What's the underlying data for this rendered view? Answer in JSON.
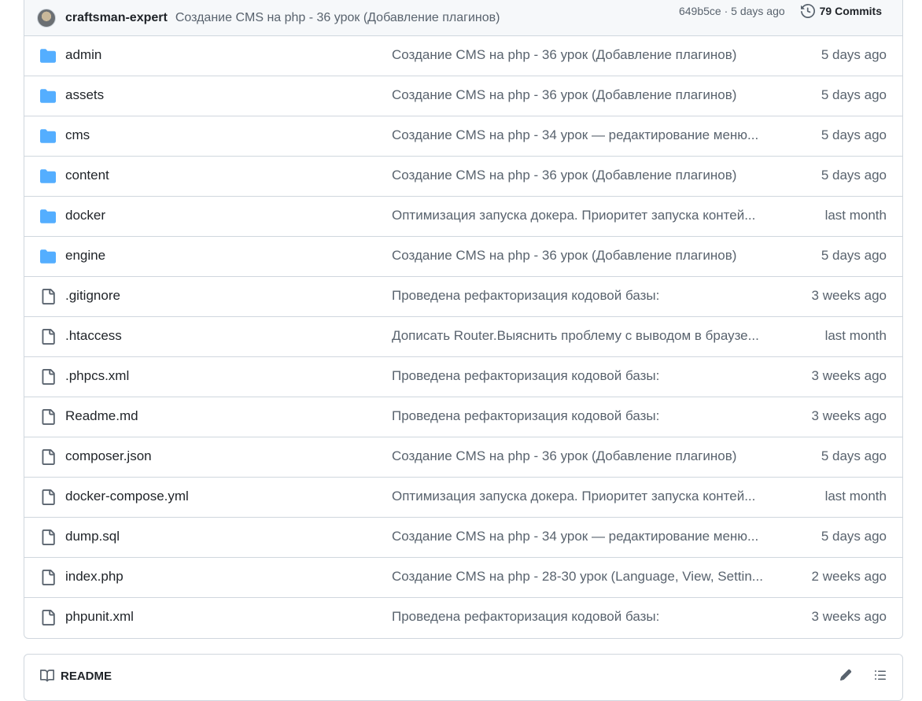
{
  "latest_commit": {
    "author": "craftsman-expert",
    "message": "Создание CMS на php - 36 урок (Добавление плагинов)",
    "sha_time": "649b5ce · 5 days ago",
    "commits_label": "79 Commits"
  },
  "files": [
    {
      "type": "folder",
      "name": "admin",
      "message": "Создание CMS на php - 36 урок (Добавление плагинов)",
      "age": "5 days ago"
    },
    {
      "type": "folder",
      "name": "assets",
      "message": "Создание CMS на php - 36 урок (Добавление плагинов)",
      "age": "5 days ago"
    },
    {
      "type": "folder",
      "name": "cms",
      "message": "Создание CMS на php - 34 урок — редактирование меню...",
      "age": "5 days ago"
    },
    {
      "type": "folder",
      "name": "content",
      "message": "Создание CMS на php - 36 урок (Добавление плагинов)",
      "age": "5 days ago"
    },
    {
      "type": "folder",
      "name": "docker",
      "message": "Оптимизация запуска докера. Приоритет запуска контей...",
      "age": "last month"
    },
    {
      "type": "folder",
      "name": "engine",
      "message": "Создание CMS на php - 36 урок (Добавление плагинов)",
      "age": "5 days ago"
    },
    {
      "type": "file",
      "name": ".gitignore",
      "message": "Проведена рефакторизация кодовой базы:",
      "age": "3 weeks ago"
    },
    {
      "type": "file",
      "name": ".htaccess",
      "message": "Дописать Router.Выяснить проблему с выводом в браузе...",
      "age": "last month"
    },
    {
      "type": "file",
      "name": ".phpcs.xml",
      "message": "Проведена рефакторизация кодовой базы:",
      "age": "3 weeks ago"
    },
    {
      "type": "file",
      "name": "Readme.md",
      "message": "Проведена рефакторизация кодовой базы:",
      "age": "3 weeks ago"
    },
    {
      "type": "file",
      "name": "composer.json",
      "message": "Создание CMS на php - 36 урок (Добавление плагинов)",
      "age": "5 days ago"
    },
    {
      "type": "file",
      "name": "docker-compose.yml",
      "message": "Оптимизация запуска докера. Приоритет запуска контей...",
      "age": "last month"
    },
    {
      "type": "file",
      "name": "dump.sql",
      "message": "Создание CMS на php - 34 урок — редактирование меню...",
      "age": "5 days ago"
    },
    {
      "type": "file",
      "name": "index.php",
      "message": "Создание CMS на php - 28-30 урок (Language, View, Settin...",
      "age": "2 weeks ago"
    },
    {
      "type": "file",
      "name": "phpunit.xml",
      "message": "Проведена рефакторизация кодовой базы:",
      "age": "3 weeks ago"
    }
  ],
  "readme": {
    "title": "README"
  },
  "colors": {
    "folder": "#54aeff",
    "file_icon": "#59636e",
    "border": "#d0d7de"
  }
}
